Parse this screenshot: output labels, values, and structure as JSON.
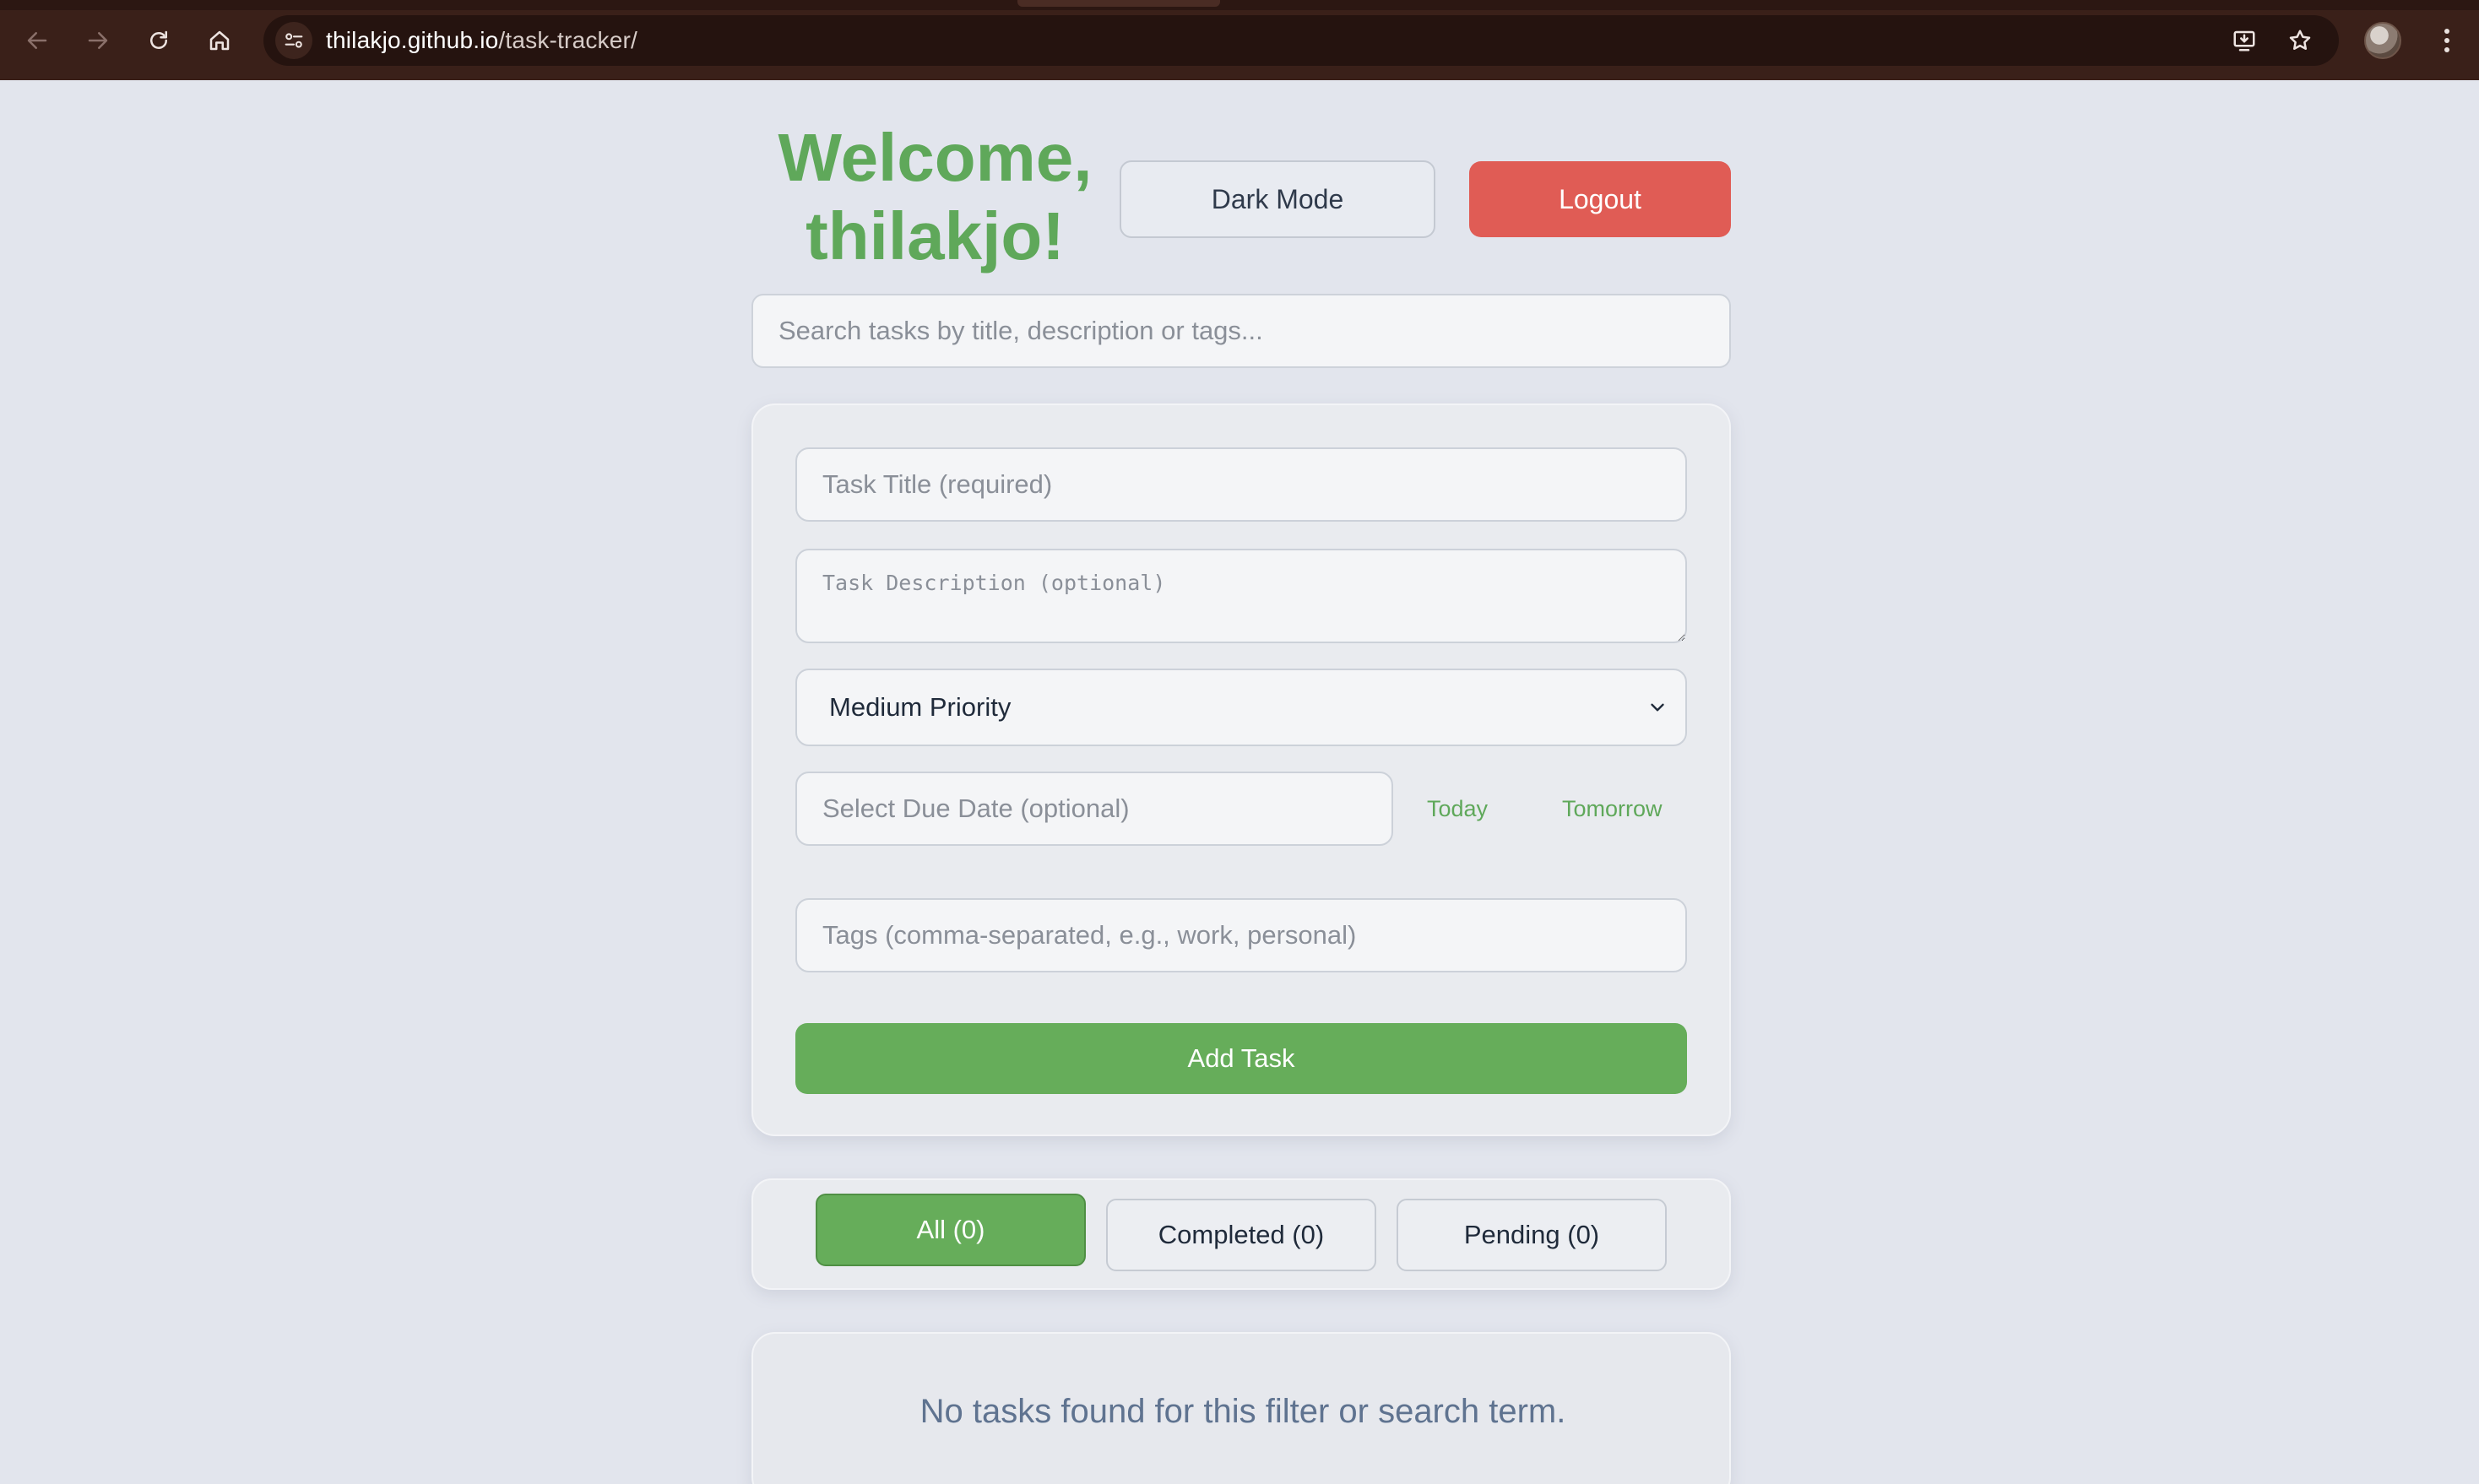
{
  "browser": {
    "url_host": "thilakjo.github.io",
    "url_path": "/task-tracker/",
    "icons": [
      "back-arrow-icon",
      "forward-arrow-icon",
      "reload-icon",
      "home-icon",
      "site-info-icon",
      "install-app-icon",
      "bookmark-star-icon",
      "profile-avatar",
      "kebab-menu-icon"
    ]
  },
  "header": {
    "welcome_line1": "Welcome,",
    "welcome_line2": "thilakjo!",
    "dark_mode_label": "Dark Mode",
    "logout_label": "Logout"
  },
  "search": {
    "placeholder": "Search tasks by title, description or tags...",
    "value": ""
  },
  "form": {
    "title_placeholder": "Task Title (required)",
    "description_placeholder": "Task Description (optional)",
    "priority_selected": "Medium Priority",
    "due_placeholder": "Select Due Date (optional)",
    "today_label": "Today",
    "tomorrow_label": "Tomorrow",
    "tags_placeholder": "Tags (comma-separated, e.g., work, personal)",
    "add_label": "Add Task"
  },
  "filters": {
    "all_label": "All (0)",
    "completed_label": "Completed (0)",
    "pending_label": "Pending (0)",
    "active": "All (0)"
  },
  "tasks": {
    "empty_message": "No tasks found for this filter or search term."
  },
  "colors": {
    "accent_green": "#66ad5a",
    "logout_red": "#e05c55",
    "page_background": "#e2e5ed",
    "chrome_background": "#3a2019"
  }
}
